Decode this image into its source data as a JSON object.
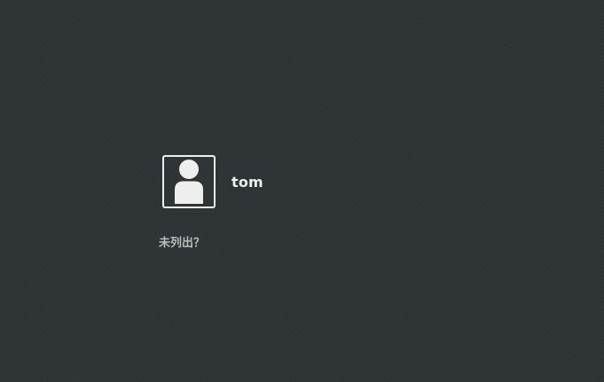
{
  "login": {
    "users": [
      {
        "name": "tom",
        "avatar_icon": "user-avatar-icon"
      }
    ],
    "not_listed_label": "未列出？"
  },
  "colors": {
    "background": "#2e3436",
    "foreground": "#eeeeec",
    "secondary_text": "#babdb6"
  }
}
